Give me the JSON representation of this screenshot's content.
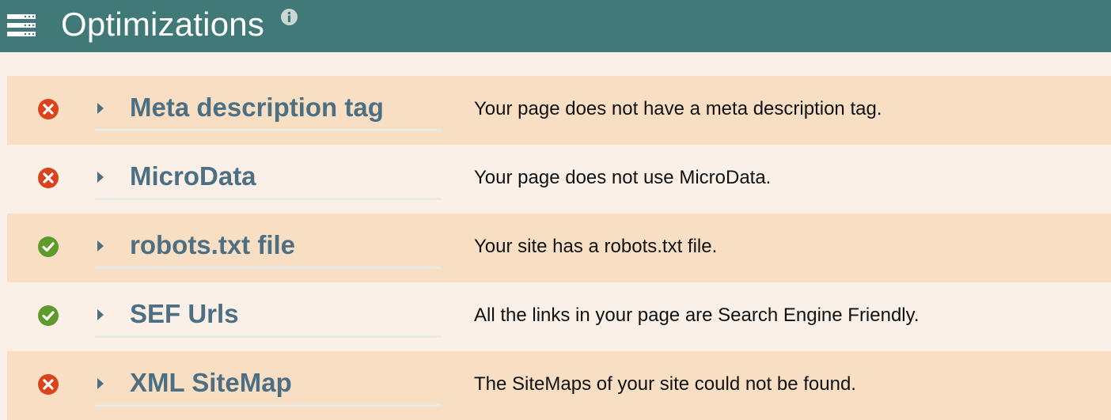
{
  "header": {
    "title": "Optimizations",
    "menu_icon": "server-list-icon",
    "info_icon": "info-icon",
    "background_color": "#407978"
  },
  "colors": {
    "fail": "#d9431e",
    "pass": "#5f9b2c",
    "title_text": "#4d6f83",
    "row_highlight": "#f8dfc4",
    "row_plain": "#faf0e8"
  },
  "rows": [
    {
      "status": "fail",
      "status_icon": "x-circle-icon",
      "title": "Meta description tag",
      "description": "Your page does not have a meta description tag."
    },
    {
      "status": "fail",
      "status_icon": "x-circle-icon",
      "title": "MicroData",
      "description": "Your page does not use MicroData."
    },
    {
      "status": "pass",
      "status_icon": "check-circle-icon",
      "title": "robots.txt file",
      "description": "Your site has a robots.txt file."
    },
    {
      "status": "pass",
      "status_icon": "check-circle-icon",
      "title": "SEF Urls",
      "description": "All the links in your page are Search Engine Friendly."
    },
    {
      "status": "fail",
      "status_icon": "x-circle-icon",
      "title": "XML SiteMap",
      "description": "The SiteMaps of your site could not be found."
    }
  ]
}
